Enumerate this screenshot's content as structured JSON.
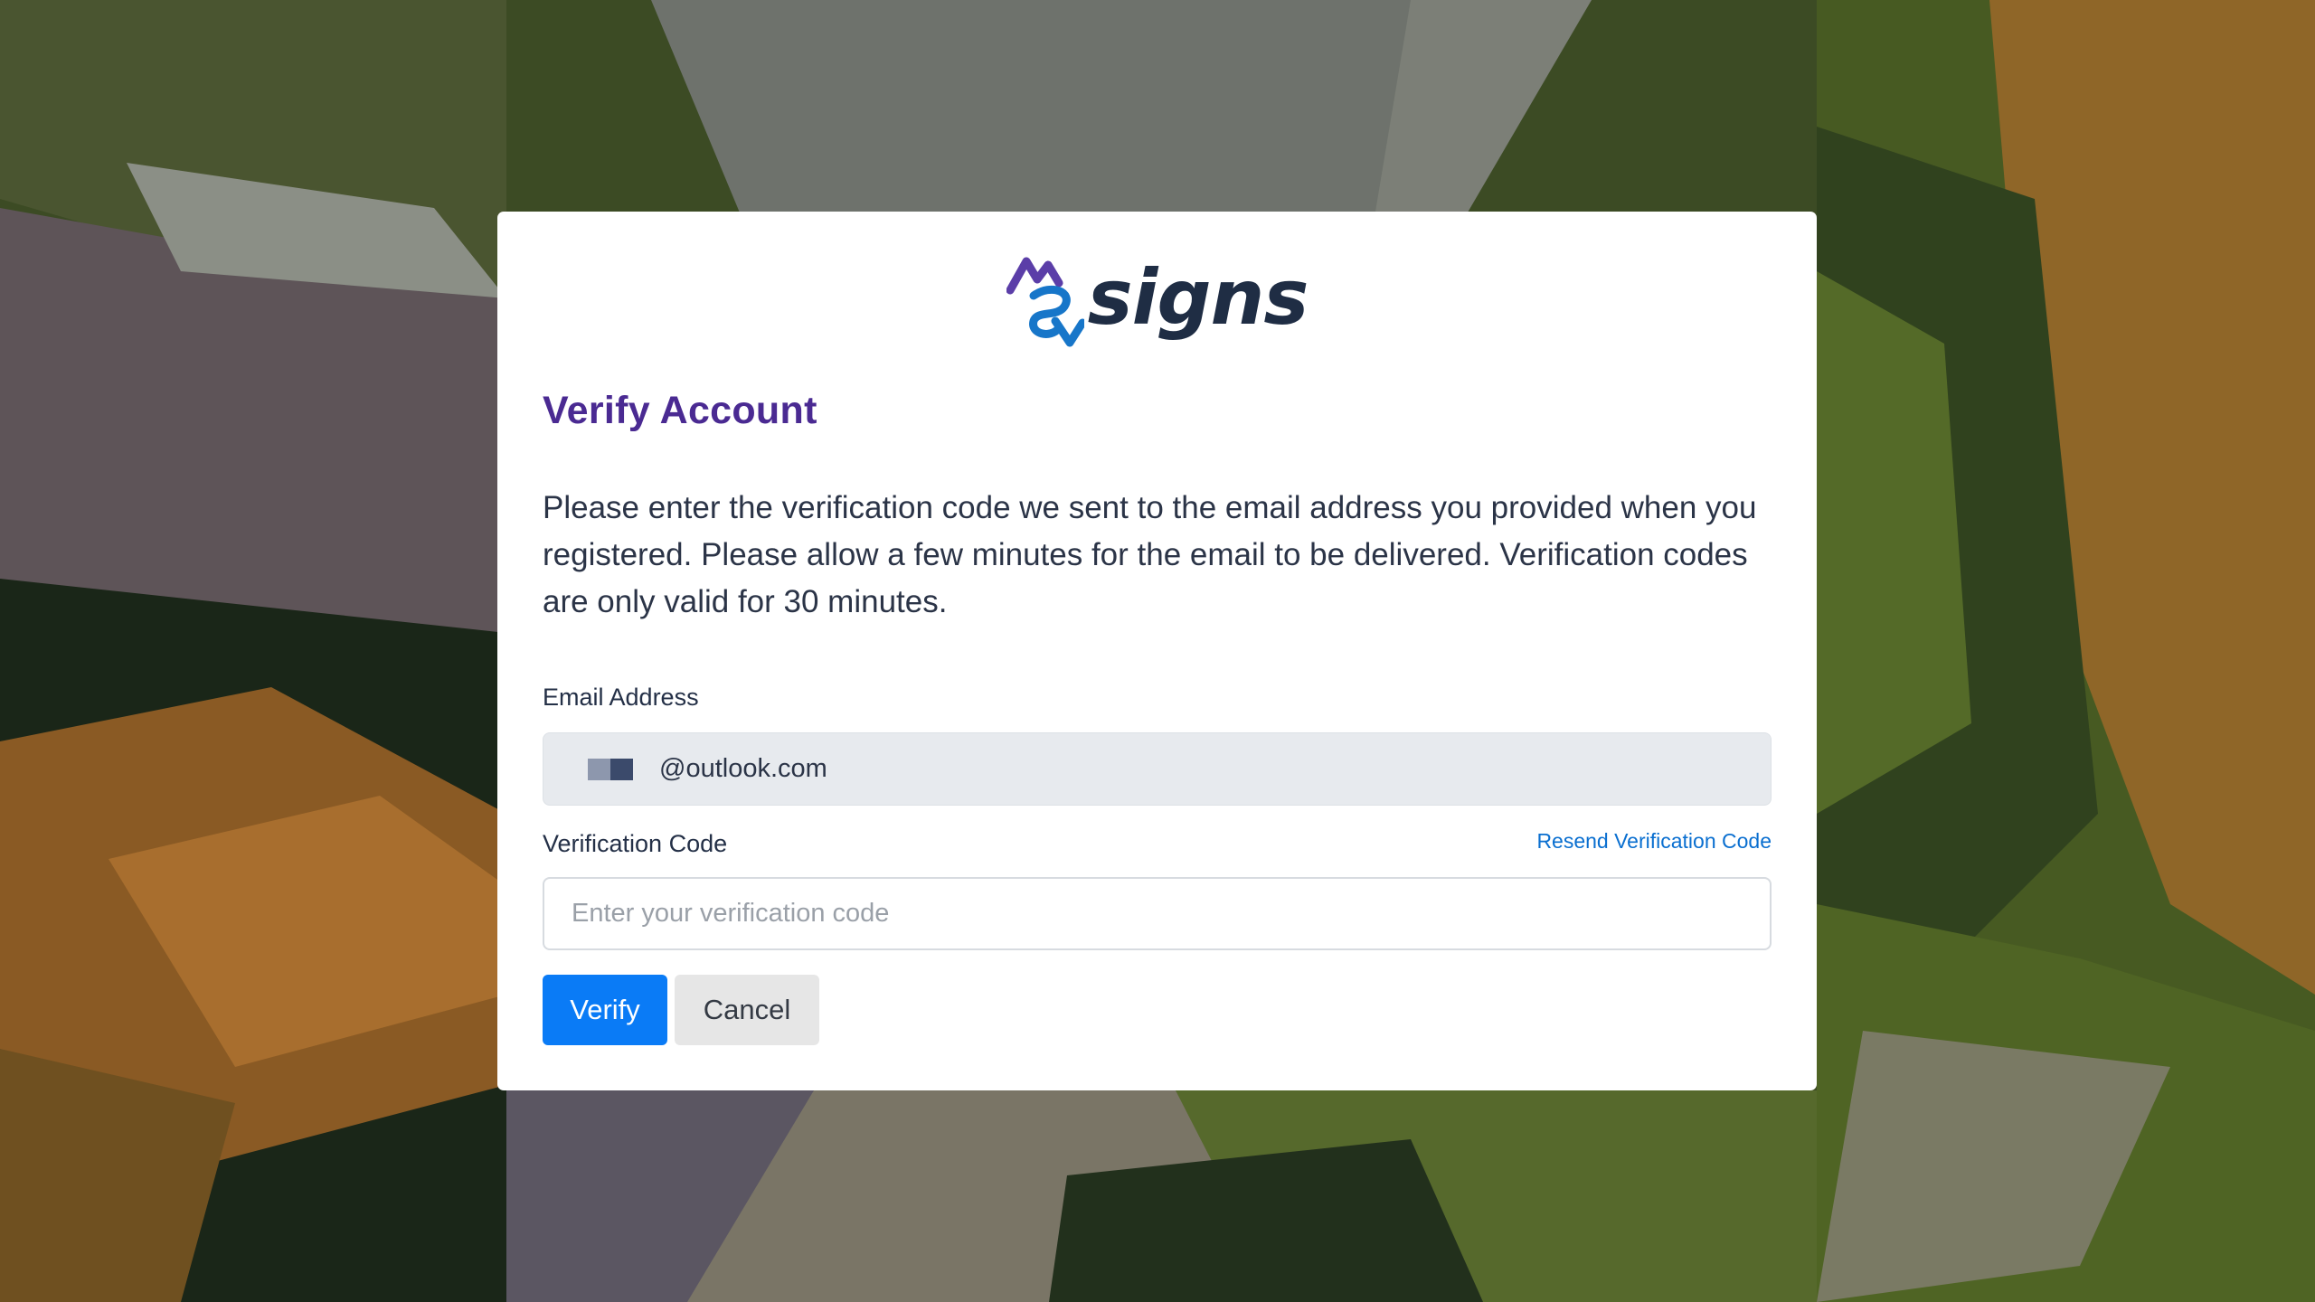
{
  "brand": {
    "name": "signs",
    "colors": {
      "mark_purple": "#5b3ea8",
      "mark_blue": "#1776c9",
      "wordmark": "#1f2d44"
    }
  },
  "page": {
    "title": "Verify Account",
    "description": "Please enter the verification code we sent to the email address you provided when you registered. Please allow a few minutes for the email to be delivered. Verification codes are only valid for 30 minutes."
  },
  "email": {
    "label": "Email Address",
    "value": "@outlook.com"
  },
  "code": {
    "label": "Verification Code",
    "placeholder": "Enter your verification code",
    "resend_label": "Resend Verification Code"
  },
  "actions": {
    "verify_label": "Verify",
    "cancel_label": "Cancel"
  },
  "colors": {
    "title": "#4a2a92",
    "primary_button": "#0a7bf6",
    "link": "#0a6fd0"
  }
}
